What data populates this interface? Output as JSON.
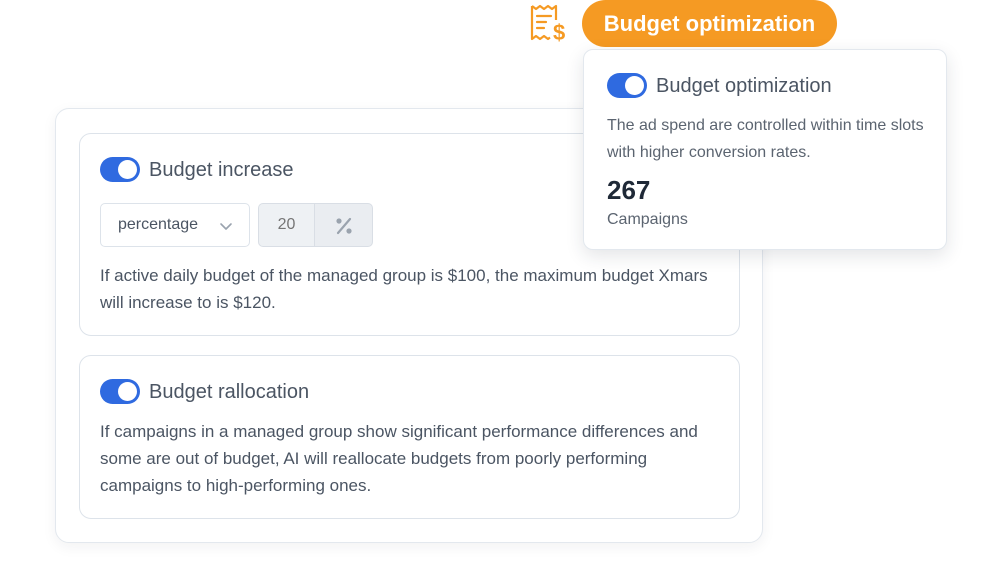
{
  "header": {
    "badge_label": "Budget optimization",
    "badge_icon": "receipt-dollar-icon",
    "accent_color": "#f59a23"
  },
  "popover": {
    "title": "Budget optimization",
    "toggle_on": true,
    "description": "The ad spend are controlled within time slots with higher conversion rates.",
    "stat_value": "267",
    "stat_label": "Campaigns"
  },
  "sections": {
    "budget_increase": {
      "title": "Budget increase",
      "toggle_on": true,
      "mode_select": {
        "value": "percentage",
        "icon": "chevron-down-icon"
      },
      "amount_input": {
        "placeholder": "20"
      },
      "unit_icon": "percent-icon",
      "description": "If active daily budget of the managed group is $100, the maximum budget Xmars will increase to is $120."
    },
    "budget_reallocation": {
      "title": "Budget rallocation",
      "toggle_on": true,
      "description": "If campaigns in a managed group show significant performance differences and some are out of budget, AI will reallocate budgets from poorly performing campaigns to high-performing ones."
    }
  },
  "colors": {
    "toggle_on": "#2f6ae0",
    "text_primary": "#4b5563",
    "border": "#dde3ea"
  }
}
